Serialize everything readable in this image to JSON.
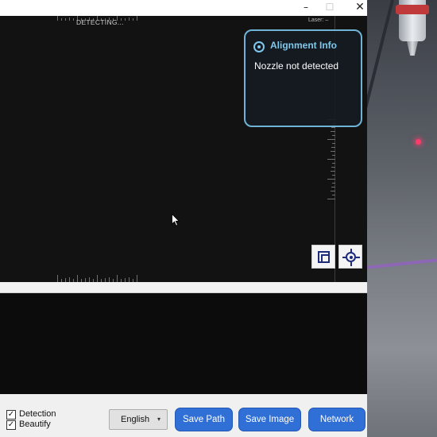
{
  "window": {
    "controls": {
      "minimize_icon": "–",
      "maximize_icon": "☐",
      "close_icon": "✕"
    }
  },
  "camera": {
    "status_text": "DETECTING...",
    "laser_label": "Laser: –"
  },
  "alignment_info": {
    "title": "Alignment Info",
    "status": "Nozzle not detected",
    "icon": "target-circle-icon",
    "border_color": "#6fb3d6",
    "title_color": "#7fc8ee"
  },
  "view_controls": {
    "frame_icon": "frame-icon",
    "target_icon": "crosshair-target-icon"
  },
  "options": {
    "detection": {
      "label": "Detection",
      "checked": true,
      "mark": "✓"
    },
    "beautify": {
      "label": "Beautify",
      "checked": true,
      "mark": "✓"
    }
  },
  "language": {
    "selected": "English",
    "arrow": "▾"
  },
  "actions": {
    "save_path": "Save Path",
    "save_image": "Save Image",
    "network": "Network",
    "color": "#2f6fd6"
  }
}
